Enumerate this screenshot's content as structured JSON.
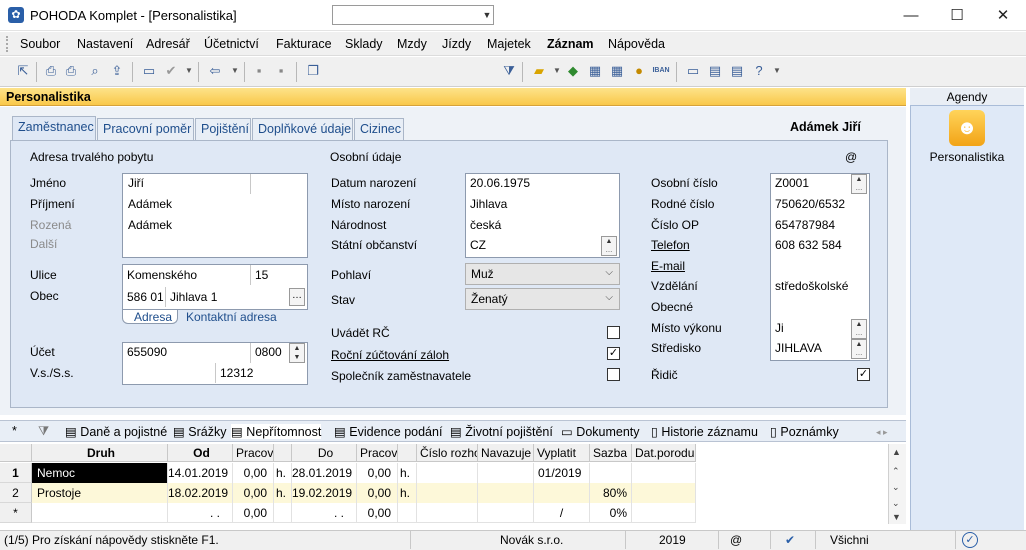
{
  "window": {
    "title": "POHODA Komplet - [Personalistika]",
    "app_icon": "pohoda-logo-icon"
  },
  "menu": [
    "Soubor",
    "Nastavení",
    "Adresář",
    "Účetnictví",
    "Fakturace",
    "Sklady",
    "Mzdy",
    "Jízdy",
    "Majetek",
    "Záznam",
    "Nápověda"
  ],
  "agenda": {
    "title": "Personalistika"
  },
  "right_panel": {
    "title": "Agendy",
    "item_label": "Personalistika"
  },
  "tabs": [
    "Zaměstnanec",
    "Pracovní poměr",
    "Pojištění",
    "Doplňkové údaje",
    "Cizinec"
  ],
  "employee_name": "Adámek Jiří",
  "address": {
    "section_title": "Adresa trvalého pobytu",
    "labels": {
      "first_name": "Jméno",
      "last_name": "Příjmení",
      "born": "Rozená",
      "other": "Další",
      "street": "Ulice",
      "city": "Obec"
    },
    "first_name": "Jiří",
    "last_name": "Adámek",
    "born": "Adámek",
    "street": "Komenského",
    "street_no": "15",
    "zip": "586 01",
    "city": "Jihlava 1",
    "subtabs": [
      "Adresa",
      "Kontaktní adresa"
    ]
  },
  "account": {
    "labels": {
      "account": "Účet",
      "vs": "V.s./S.s."
    },
    "number": "655090",
    "bank_code": "0800",
    "vs": "12312"
  },
  "personal": {
    "section_title": "Osobní údaje",
    "at_symbol": "@",
    "labels": {
      "birth_date": "Datum narození",
      "birth_place": "Místo narození",
      "nationality": "Národnost",
      "citizenship": "Státní občanství",
      "gender": "Pohlaví",
      "status": "Stav"
    },
    "birth_date": "20.06.1975",
    "birth_place": "Jihlava",
    "nationality": "česká",
    "citizenship": "CZ",
    "gender": "Muž",
    "status": "Ženatý",
    "checks": [
      {
        "label": "Uvádět RČ",
        "checked": false
      },
      {
        "label": "Roční zúčtování záloh",
        "checked": true
      },
      {
        "label": "Společník zaměstnavatele",
        "checked": false
      }
    ]
  },
  "ids": {
    "labels": {
      "personal_no": "Osobní číslo",
      "birth_no": "Rodné číslo",
      "op": "Číslo OP",
      "phone": "Telefon",
      "email": "E-mail",
      "education": "Vzdělání",
      "general": "Obecné",
      "workplace": "Místo výkonu",
      "center": "Středisko",
      "driver": "Řidič"
    },
    "personal_no": "Z0001",
    "birth_no": "750620/6532",
    "op": "654787984",
    "phone": "608 632 584",
    "education": "středoškolské",
    "workplace": "Ji",
    "center": "JIHLAVA",
    "driver_checked": true
  },
  "bottom_tabs": [
    "Daně a pojistné",
    "Srážky",
    "Nepřítomnost",
    "Evidence podání",
    "Životní pojištění",
    "Dokumenty",
    "Historie záznamu",
    "Poznámky"
  ],
  "bottom_tabs_prefix": "*",
  "grid": {
    "headers": [
      "Druh",
      "Od",
      "Pracova",
      "",
      "Do",
      "Pracova",
      "",
      "Číslo rozho",
      "Navazuje",
      "Vyplatit",
      "Sazba",
      "Dat.porodu"
    ],
    "rows": [
      {
        "num": "1",
        "cells": [
          "Nemoc",
          "14.01.2019",
          "0,00",
          "h.",
          "28.01.2019",
          "0,00",
          "h.",
          "",
          "",
          "01/2019",
          "",
          ""
        ]
      },
      {
        "num": "2",
        "cells": [
          "Prostoje",
          "18.02.2019",
          "0,00",
          "h.",
          "19.02.2019",
          "0,00",
          "h.",
          "",
          "",
          "",
          "80%",
          ""
        ]
      },
      {
        "num": "*",
        "cells": [
          "",
          "  .  .",
          "0,00",
          "",
          "  .  .",
          "0,00",
          "",
          "",
          "",
          "/",
          "0%",
          ""
        ]
      }
    ]
  },
  "status": {
    "help": "(1/5) Pro získání nápovědy stiskněte F1.",
    "company": "Novák s.r.o.",
    "year": "2019",
    "at": "@",
    "filter": "Všichni"
  }
}
